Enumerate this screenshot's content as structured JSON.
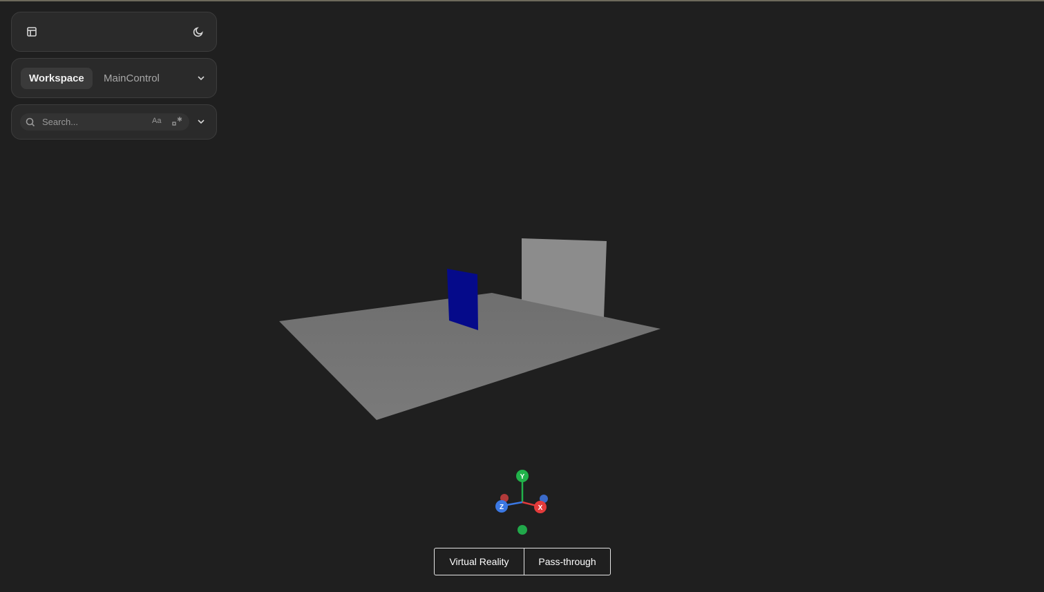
{
  "header": {
    "layout_icon": "panel-layout-icon",
    "theme_icon": "moon-icon"
  },
  "tabs": {
    "items": [
      {
        "label": "Workspace",
        "active": true
      },
      {
        "label": "MainControl",
        "active": false
      }
    ],
    "dropdown_icon": "chevron-down-icon"
  },
  "search": {
    "placeholder": "Search...",
    "value": "",
    "case_label": "Aa",
    "regex_icon": "regex-icon",
    "expand_icon": "chevron-down-icon"
  },
  "scene": {
    "floor_color": "#747474",
    "blue_panel_color": "#050a8a",
    "gray_panel_color": "#8c8c8c",
    "axis_gizmo": {
      "y_label": "Y",
      "x_label": "X",
      "z_label": "Z",
      "y_color": "#21b24a",
      "x_color": "#e33b3b",
      "z_color": "#3b78e3"
    }
  },
  "mode_toggle": {
    "vr_label": "Virtual Reality",
    "passthrough_label": "Pass-through"
  }
}
